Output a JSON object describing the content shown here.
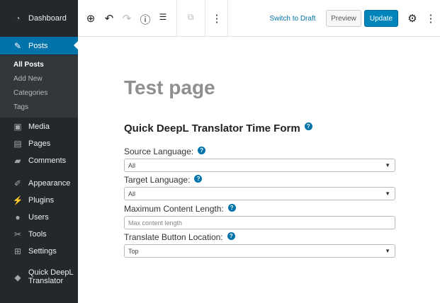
{
  "sidebar": {
    "items": [
      {
        "label": "Dashboard",
        "icon": "dashboard-icon"
      },
      {
        "label": "Posts",
        "icon": "pin-icon"
      },
      {
        "label": "Media",
        "icon": "media-icon"
      },
      {
        "label": "Pages",
        "icon": "pages-icon"
      },
      {
        "label": "Comments",
        "icon": "comments-icon"
      },
      {
        "label": "Appearance",
        "icon": "appearance-icon"
      },
      {
        "label": "Plugins",
        "icon": "plugins-icon"
      },
      {
        "label": "Users",
        "icon": "users-icon"
      },
      {
        "label": "Tools",
        "icon": "tools-icon"
      },
      {
        "label": "Settings",
        "icon": "settings-icon"
      },
      {
        "label": "Quick DeepL",
        "label2": "Translator",
        "icon": "deepl-icon"
      }
    ],
    "submenu": [
      "All Posts",
      "Add New",
      "Categories",
      "Tags"
    ]
  },
  "toolbar": {
    "switch_draft": "Switch to Draft",
    "preview": "Preview",
    "update": "Update"
  },
  "page": {
    "title": "Test page",
    "form_title": "Quick DeepL Translator Time Form",
    "fields": [
      {
        "label": "Source Language:",
        "value": "All",
        "type": "select"
      },
      {
        "label": "Target Language:",
        "value": "All",
        "type": "select"
      },
      {
        "label": "Maximum Content Length:",
        "placeholder": "Max content length",
        "type": "input"
      },
      {
        "label": "Translate Button Location:",
        "value": "Top",
        "type": "select"
      }
    ]
  },
  "help": "?",
  "colors": {
    "accent": "#0073aa",
    "sidebar": "#23282d"
  }
}
